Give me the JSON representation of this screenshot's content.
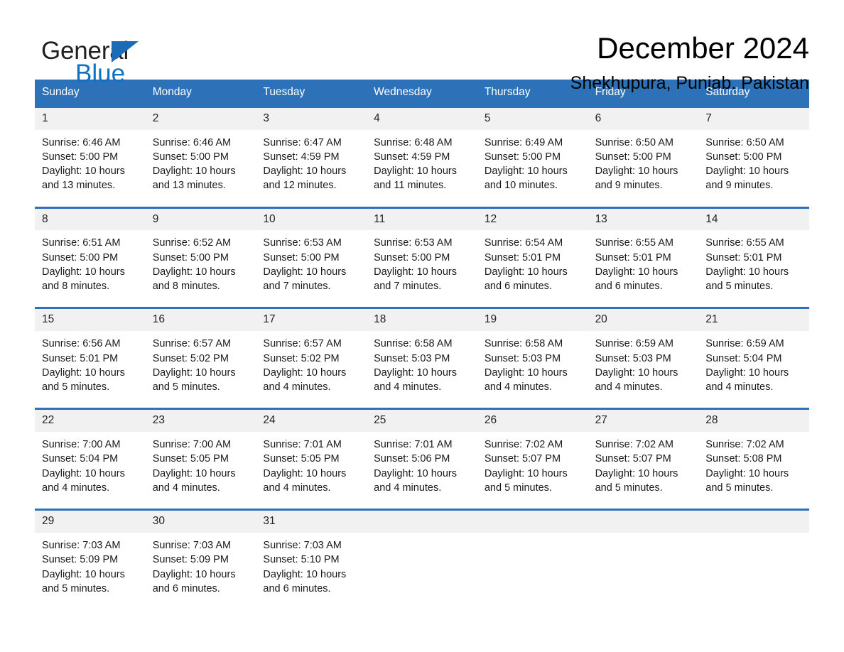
{
  "logo": {
    "word_one": "General",
    "word_two": "Blue",
    "triangle_color": "#1b6cb5",
    "blue_text_color": "#0b72c4"
  },
  "header": {
    "title": "December 2024",
    "subtitle": "Shekhupura, Punjab, Pakistan"
  },
  "colors": {
    "header_blue": "#2d72b8",
    "number_band_gray": "#f1f1f1",
    "text": "#1a1a1a"
  },
  "weekdays": [
    "Sunday",
    "Monday",
    "Tuesday",
    "Wednesday",
    "Thursday",
    "Friday",
    "Saturday"
  ],
  "weeks": [
    {
      "numbers": [
        "1",
        "2",
        "3",
        "4",
        "5",
        "6",
        "7"
      ],
      "cells": [
        {
          "sunrise": "Sunrise: 6:46 AM",
          "sunset": "Sunset: 5:00 PM",
          "daylight1": "Daylight: 10 hours",
          "daylight2": "and 13 minutes."
        },
        {
          "sunrise": "Sunrise: 6:46 AM",
          "sunset": "Sunset: 5:00 PM",
          "daylight1": "Daylight: 10 hours",
          "daylight2": "and 13 minutes."
        },
        {
          "sunrise": "Sunrise: 6:47 AM",
          "sunset": "Sunset: 4:59 PM",
          "daylight1": "Daylight: 10 hours",
          "daylight2": "and 12 minutes."
        },
        {
          "sunrise": "Sunrise: 6:48 AM",
          "sunset": "Sunset: 4:59 PM",
          "daylight1": "Daylight: 10 hours",
          "daylight2": "and 11 minutes."
        },
        {
          "sunrise": "Sunrise: 6:49 AM",
          "sunset": "Sunset: 5:00 PM",
          "daylight1": "Daylight: 10 hours",
          "daylight2": "and 10 minutes."
        },
        {
          "sunrise": "Sunrise: 6:50 AM",
          "sunset": "Sunset: 5:00 PM",
          "daylight1": "Daylight: 10 hours",
          "daylight2": "and 9 minutes."
        },
        {
          "sunrise": "Sunrise: 6:50 AM",
          "sunset": "Sunset: 5:00 PM",
          "daylight1": "Daylight: 10 hours",
          "daylight2": "and 9 minutes."
        }
      ]
    },
    {
      "numbers": [
        "8",
        "9",
        "10",
        "11",
        "12",
        "13",
        "14"
      ],
      "cells": [
        {
          "sunrise": "Sunrise: 6:51 AM",
          "sunset": "Sunset: 5:00 PM",
          "daylight1": "Daylight: 10 hours",
          "daylight2": "and 8 minutes."
        },
        {
          "sunrise": "Sunrise: 6:52 AM",
          "sunset": "Sunset: 5:00 PM",
          "daylight1": "Daylight: 10 hours",
          "daylight2": "and 8 minutes."
        },
        {
          "sunrise": "Sunrise: 6:53 AM",
          "sunset": "Sunset: 5:00 PM",
          "daylight1": "Daylight: 10 hours",
          "daylight2": "and 7 minutes."
        },
        {
          "sunrise": "Sunrise: 6:53 AM",
          "sunset": "Sunset: 5:00 PM",
          "daylight1": "Daylight: 10 hours",
          "daylight2": "and 7 minutes."
        },
        {
          "sunrise": "Sunrise: 6:54 AM",
          "sunset": "Sunset: 5:01 PM",
          "daylight1": "Daylight: 10 hours",
          "daylight2": "and 6 minutes."
        },
        {
          "sunrise": "Sunrise: 6:55 AM",
          "sunset": "Sunset: 5:01 PM",
          "daylight1": "Daylight: 10 hours",
          "daylight2": "and 6 minutes."
        },
        {
          "sunrise": "Sunrise: 6:55 AM",
          "sunset": "Sunset: 5:01 PM",
          "daylight1": "Daylight: 10 hours",
          "daylight2": "and 5 minutes."
        }
      ]
    },
    {
      "numbers": [
        "15",
        "16",
        "17",
        "18",
        "19",
        "20",
        "21"
      ],
      "cells": [
        {
          "sunrise": "Sunrise: 6:56 AM",
          "sunset": "Sunset: 5:01 PM",
          "daylight1": "Daylight: 10 hours",
          "daylight2": "and 5 minutes."
        },
        {
          "sunrise": "Sunrise: 6:57 AM",
          "sunset": "Sunset: 5:02 PM",
          "daylight1": "Daylight: 10 hours",
          "daylight2": "and 5 minutes."
        },
        {
          "sunrise": "Sunrise: 6:57 AM",
          "sunset": "Sunset: 5:02 PM",
          "daylight1": "Daylight: 10 hours",
          "daylight2": "and 4 minutes."
        },
        {
          "sunrise": "Sunrise: 6:58 AM",
          "sunset": "Sunset: 5:03 PM",
          "daylight1": "Daylight: 10 hours",
          "daylight2": "and 4 minutes."
        },
        {
          "sunrise": "Sunrise: 6:58 AM",
          "sunset": "Sunset: 5:03 PM",
          "daylight1": "Daylight: 10 hours",
          "daylight2": "and 4 minutes."
        },
        {
          "sunrise": "Sunrise: 6:59 AM",
          "sunset": "Sunset: 5:03 PM",
          "daylight1": "Daylight: 10 hours",
          "daylight2": "and 4 minutes."
        },
        {
          "sunrise": "Sunrise: 6:59 AM",
          "sunset": "Sunset: 5:04 PM",
          "daylight1": "Daylight: 10 hours",
          "daylight2": "and 4 minutes."
        }
      ]
    },
    {
      "numbers": [
        "22",
        "23",
        "24",
        "25",
        "26",
        "27",
        "28"
      ],
      "cells": [
        {
          "sunrise": "Sunrise: 7:00 AM",
          "sunset": "Sunset: 5:04 PM",
          "daylight1": "Daylight: 10 hours",
          "daylight2": "and 4 minutes."
        },
        {
          "sunrise": "Sunrise: 7:00 AM",
          "sunset": "Sunset: 5:05 PM",
          "daylight1": "Daylight: 10 hours",
          "daylight2": "and 4 minutes."
        },
        {
          "sunrise": "Sunrise: 7:01 AM",
          "sunset": "Sunset: 5:05 PM",
          "daylight1": "Daylight: 10 hours",
          "daylight2": "and 4 minutes."
        },
        {
          "sunrise": "Sunrise: 7:01 AM",
          "sunset": "Sunset: 5:06 PM",
          "daylight1": "Daylight: 10 hours",
          "daylight2": "and 4 minutes."
        },
        {
          "sunrise": "Sunrise: 7:02 AM",
          "sunset": "Sunset: 5:07 PM",
          "daylight1": "Daylight: 10 hours",
          "daylight2": "and 5 minutes."
        },
        {
          "sunrise": "Sunrise: 7:02 AM",
          "sunset": "Sunset: 5:07 PM",
          "daylight1": "Daylight: 10 hours",
          "daylight2": "and 5 minutes."
        },
        {
          "sunrise": "Sunrise: 7:02 AM",
          "sunset": "Sunset: 5:08 PM",
          "daylight1": "Daylight: 10 hours",
          "daylight2": "and 5 minutes."
        }
      ]
    },
    {
      "numbers": [
        "29",
        "30",
        "31",
        "",
        "",
        "",
        ""
      ],
      "cells": [
        {
          "sunrise": "Sunrise: 7:03 AM",
          "sunset": "Sunset: 5:09 PM",
          "daylight1": "Daylight: 10 hours",
          "daylight2": "and 5 minutes."
        },
        {
          "sunrise": "Sunrise: 7:03 AM",
          "sunset": "Sunset: 5:09 PM",
          "daylight1": "Daylight: 10 hours",
          "daylight2": "and 6 minutes."
        },
        {
          "sunrise": "Sunrise: 7:03 AM",
          "sunset": "Sunset: 5:10 PM",
          "daylight1": "Daylight: 10 hours",
          "daylight2": "and 6 minutes."
        },
        {
          "sunrise": "",
          "sunset": "",
          "daylight1": "",
          "daylight2": ""
        },
        {
          "sunrise": "",
          "sunset": "",
          "daylight1": "",
          "daylight2": ""
        },
        {
          "sunrise": "",
          "sunset": "",
          "daylight1": "",
          "daylight2": ""
        },
        {
          "sunrise": "",
          "sunset": "",
          "daylight1": "",
          "daylight2": ""
        }
      ]
    }
  ]
}
